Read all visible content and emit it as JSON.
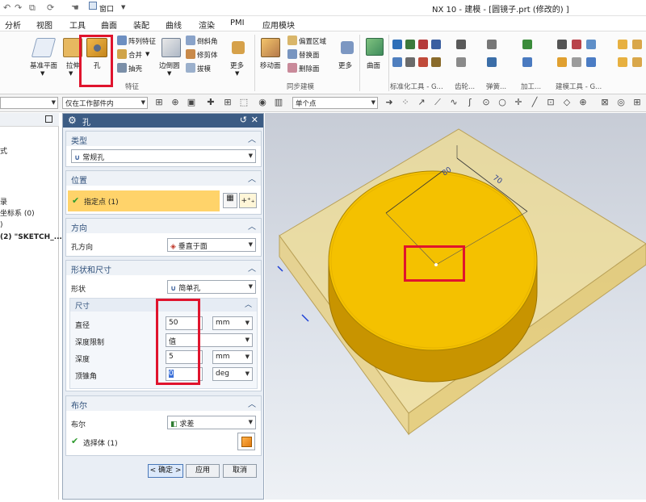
{
  "window": {
    "title": "NX 10 - 建模 - [圆镜子.prt (修改的) ]",
    "window_menu": "窗口"
  },
  "menubar": {
    "items": [
      "分析",
      "视图",
      "工具",
      "曲面",
      "装配",
      "曲线",
      "渲染",
      "PMI",
      "应用模块"
    ]
  },
  "ribbon": {
    "datum_plane": "基准平面",
    "extrude": "拉伸",
    "hole": "孔",
    "pattern_feature": "阵列特征",
    "unite": "合并",
    "shell": "抽壳",
    "face_edge": "边倒圆",
    "chamfer": "倒斜角",
    "trim_body": "修剪体",
    "draft": "拔模",
    "more": "更多",
    "feature_group": "特征",
    "move_face": "移动面",
    "offset_region": "偏置区域",
    "replace_face": "替换面",
    "delete_face": "删除面",
    "more2": "更多",
    "sync_group": "同步建模",
    "surface": "曲面",
    "std_tools": "标准化工具 - G...",
    "gear": "齿轮...",
    "spring": "弹簧...",
    "machining": "加工...",
    "build_tools": "建模工具 - G..."
  },
  "selbar": {
    "filter": "仅在工作部件内",
    "snap": "单个点"
  },
  "nav": {
    "rows": [
      "式",
      "录",
      "坐标系 (0)",
      ")",
      "(2) \"SKETCH_..."
    ]
  },
  "dialog": {
    "title": "孔",
    "type": {
      "header": "类型",
      "value": "常规孔"
    },
    "position": {
      "header": "位置",
      "value": "指定点 (1)"
    },
    "direction": {
      "header": "方向",
      "label": "孔方向",
      "value": "垂直于面"
    },
    "shape": {
      "header": "形状和尺寸",
      "shape_label": "形状",
      "shape_value": "简单孔",
      "dims_header": "尺寸",
      "diameter_label": "直径",
      "diameter_value": "50",
      "diameter_unit": "mm",
      "depth_limit_label": "深度限制",
      "depth_limit_value": "值",
      "depth_label": "深度",
      "depth_value": "5",
      "depth_unit": "mm",
      "tip_angle_label": "顶锥角",
      "tip_angle_value": "0",
      "tip_angle_unit": "deg"
    },
    "boolean": {
      "header": "布尔",
      "label": "布尔",
      "value": "求差",
      "select": "选择体 (1)"
    },
    "buttons": {
      "ok": "< 确定 >",
      "apply": "应用",
      "cancel": "取消"
    }
  },
  "viewport": {
    "dim1": "80",
    "dim2": "70"
  },
  "colors": {
    "dialog_title": "#3c5c84",
    "highlight": "#ffd36a",
    "part_yellow": "#f4c100",
    "part_translucent": "#f1dd8c",
    "annotation_red": "#e0142d"
  }
}
